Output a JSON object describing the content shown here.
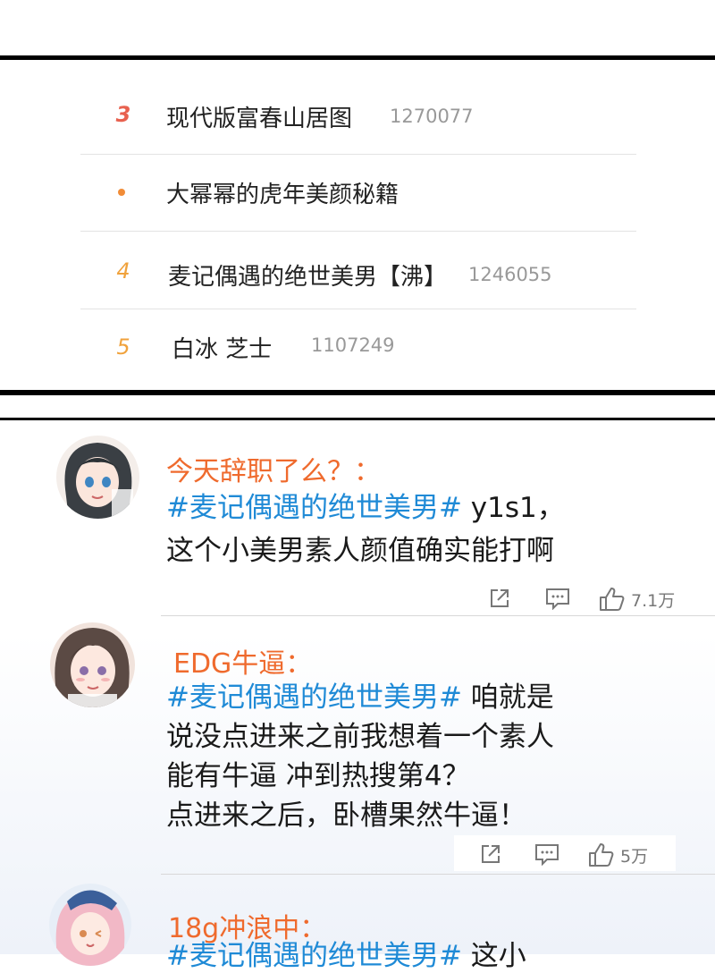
{
  "hot_list": {
    "items": [
      {
        "rank": "3",
        "title": "现代版富春山居图",
        "count": "1270077",
        "rank_color": "#e8614f"
      },
      {
        "rank": "",
        "title": "大幂幂的虎年美颜秘籍",
        "count": "",
        "rank_color": "#f18c37"
      },
      {
        "rank": "4",
        "title": "麦记偶遇的绝世美男【沸】",
        "count": "1246055",
        "rank_color": "#f0a23c"
      },
      {
        "rank": "5",
        "title": "白冰 芝士",
        "count": "1107249",
        "rank_color": "#f0a23c"
      }
    ]
  },
  "comments": [
    {
      "user": "今天辞职了么？：",
      "hashtag": "#麦记偶遇的绝世美男#",
      "line1_rest": " y1s1，",
      "lines": [
        "这个小美男素人颜值确实能打啊"
      ],
      "likes": "7.1万"
    },
    {
      "user": "EDG牛逼：",
      "hashtag": "#麦记偶遇的绝世美男#",
      "line1_rest": " 咱就是",
      "lines": [
        "说没点进来之前我想着一个素人",
        "能有牛逼 冲到热搜第4？",
        "点进来之后，卧槽果然牛逼！"
      ],
      "likes": "5万"
    },
    {
      "user": "18g冲浪中：",
      "hashtag": "#麦记偶遇的绝世美男#",
      "line1_rest": " 这小"
    }
  ],
  "icons": {
    "share": "share-icon",
    "comment": "comment-icon",
    "like": "thumbs-up-icon"
  },
  "colors": {
    "username": "#ef6a2d",
    "hashtag": "#1f8ad6"
  }
}
